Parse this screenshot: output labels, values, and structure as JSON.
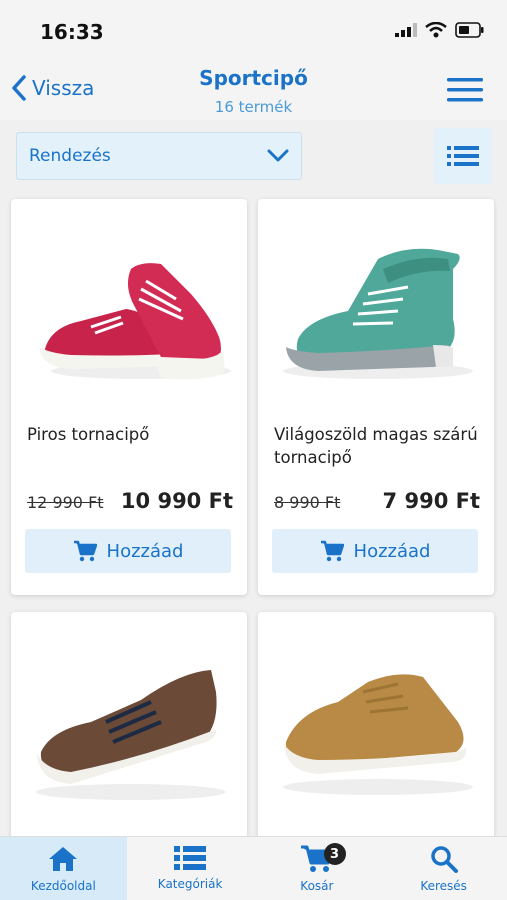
{
  "status_bar": {
    "time": "16:33"
  },
  "nav": {
    "back_label": "Vissza",
    "title": "Sportcipő",
    "subtitle": "16 termék"
  },
  "toolbar": {
    "sort_label": "Rendezés"
  },
  "products": [
    {
      "name": "Piros tornacipő",
      "old_price": "12 990 Ft",
      "price": "10 990 Ft",
      "add_label": "Hozzáad",
      "color": "#c8234a"
    },
    {
      "name": "Világoszöld magas szárú tornacipő",
      "old_price": "8 990 Ft",
      "price": "7 990 Ft",
      "add_label": "Hozzáad",
      "color": "#4fa89a"
    },
    {
      "name": "",
      "old_price": "",
      "price": "",
      "add_label": "",
      "color": "#6b4a37"
    },
    {
      "name": "",
      "old_price": "",
      "price": "",
      "add_label": "",
      "color": "#b88a45"
    }
  ],
  "tabs": [
    {
      "label": "Kezdőoldal",
      "icon": "home-icon",
      "active": true
    },
    {
      "label": "Kategóriák",
      "icon": "list-icon",
      "active": false
    },
    {
      "label": "Kosár",
      "icon": "cart-icon",
      "active": false,
      "badge": "3"
    },
    {
      "label": "Keresés",
      "icon": "search-icon",
      "active": false
    }
  ],
  "colors": {
    "accent": "#1a73c8",
    "button_bg": "#e0effa"
  }
}
